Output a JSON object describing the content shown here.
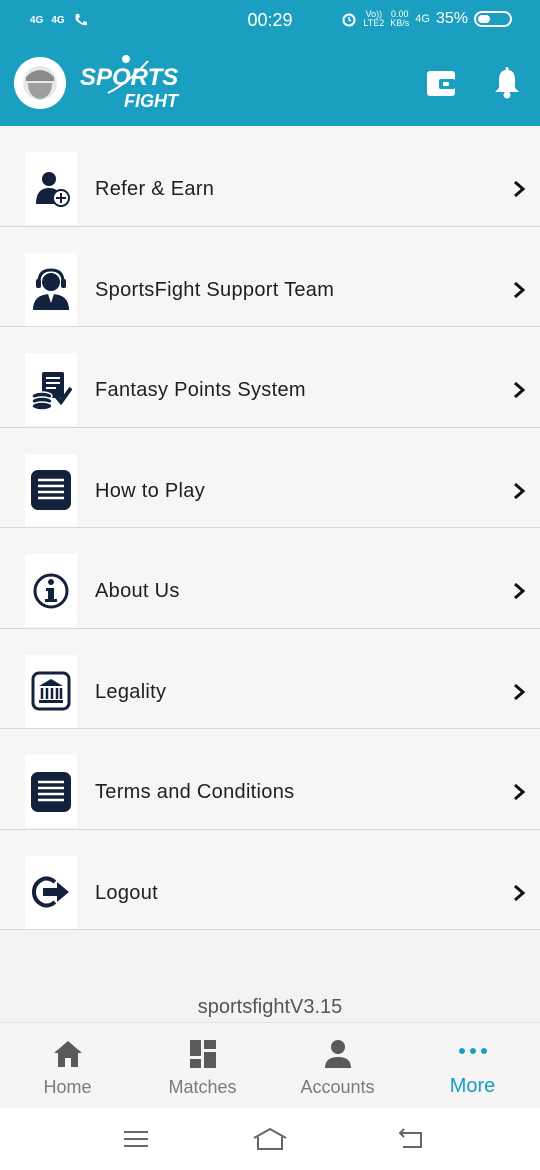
{
  "status_bar": {
    "network_1": "4G",
    "network_2": "4G",
    "time": "00:29",
    "volte": "Vo))",
    "lte": "LTE2",
    "speed": "0.00",
    "speed_unit": "KB/s",
    "network_3": "4G",
    "battery": "35%",
    "battery_level": 0.35
  },
  "header": {
    "logo_line1": "SPORTS",
    "logo_line2": "FIGHT",
    "colors": {
      "primary": "#1a9fc0"
    }
  },
  "menu": [
    {
      "label": "Refer & Earn",
      "icon": "refer-user-plus-icon"
    },
    {
      "label": "SportsFight Support Team",
      "icon": "support-headset-icon"
    },
    {
      "label": "Fantasy Points System",
      "icon": "points-coins-icon"
    },
    {
      "label": "How to Play",
      "icon": "document-lines-icon"
    },
    {
      "label": "About Us",
      "icon": "info-icon"
    },
    {
      "label": "Legality",
      "icon": "courthouse-icon"
    },
    {
      "label": "Terms and Conditions",
      "icon": "document-lines-icon"
    },
    {
      "label": "Logout",
      "icon": "logout-icon"
    }
  ],
  "version": "sportsfightV3.15",
  "bottom_nav": [
    {
      "label": "Home",
      "icon": "home-icon",
      "active": false
    },
    {
      "label": "Matches",
      "icon": "matches-grid-icon",
      "active": false
    },
    {
      "label": "Accounts",
      "icon": "person-icon",
      "active": false
    },
    {
      "label": "More",
      "icon": "more-dots-icon",
      "active": true
    }
  ]
}
